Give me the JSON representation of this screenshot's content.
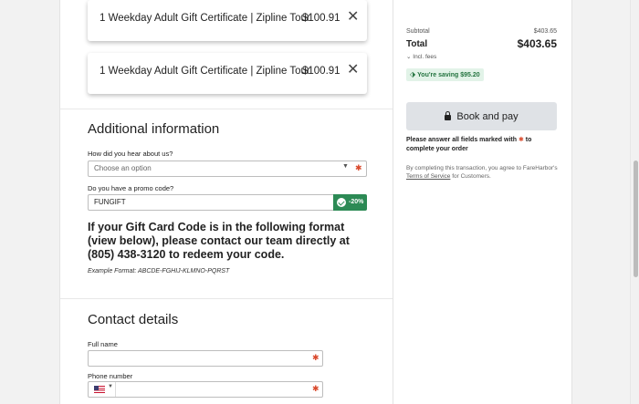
{
  "gift_items": [
    {
      "name": "1 Weekday Adult Gift Certificate | Zipline Tour",
      "price": "$100.91",
      "remove_icon": "close-icon"
    },
    {
      "name": "1 Weekday Adult Gift Certificate | Zipline Tour",
      "price": "$100.91",
      "remove_icon": "close-icon"
    }
  ],
  "additional_info": {
    "title": "Additional information",
    "hear_label": "How did you hear about us?",
    "hear_placeholder": "Choose an option",
    "promo_label": "Do you have a promo code?",
    "promo_value": "FUNGIFT",
    "promo_discount": "-20%",
    "gift_note": "If your Gift Card Code is in the following format (view below), please contact our team directly at (805) 438-3120 to redeem your code.",
    "example_format": "Example Format: ABCDE-FGHIJ-KLMNO-PQRST"
  },
  "contact": {
    "title": "Contact details",
    "fullname_label": "Full name",
    "phone_label": "Phone number"
  },
  "summary": {
    "subtotal_label": "Subtotal",
    "subtotal_value": "$403.65",
    "total_label": "Total",
    "total_value": "$403.65",
    "fees_label": "Incl. fees",
    "saving_text": "You're saving $95.20",
    "book_label": "Book and pay",
    "warn_before": "Please answer all fields marked with",
    "warn_after": "to complete your order",
    "terms_before": "By completing this transaction, you agree to FareHarbor's",
    "terms_link": "Terms of Service",
    "terms_after": "for Customers."
  },
  "colors": {
    "required_star": "#d9482b",
    "promo_success": "#2c8a55",
    "saving_bg": "#e2f3e8",
    "button_bg": "#dfe2e6"
  }
}
